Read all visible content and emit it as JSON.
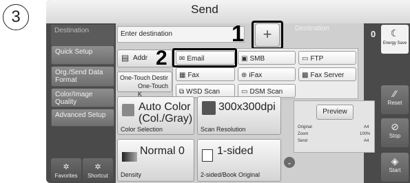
{
  "step_number": "3",
  "header": {
    "title": "Send"
  },
  "nav": {
    "destination": "Destination",
    "quick_setup": "Quick Setup",
    "org_send": "Org./Send Data Format",
    "color_image": "Color/Image Quality",
    "advanced": "Advanced Setup",
    "favorites": "Favorites",
    "shortcut": "Shortcut"
  },
  "main": {
    "dest_placeholder": "Enter destination",
    "plus_label": "+",
    "address_book": "Addr",
    "one_touch_line1": "One-Touch Destir",
    "one_touch_line2": "One-Touch K"
  },
  "menu": {
    "email": "Email",
    "smb": "SMB",
    "ftp": "FTP",
    "fax": "Fax",
    "ifax": "iFax",
    "fax_server": "Fax Server",
    "wsd_scan": "WSD Scan",
    "dsm_scan": "DSM Scan"
  },
  "callouts": {
    "one": "1",
    "two": "2"
  },
  "tiles": {
    "color_value": "Auto Color (Col./Gray)",
    "color_label": "Color Selection",
    "res_value": "300x300dpi",
    "res_label": "Scan Resolution",
    "density_value": "Normal 0",
    "density_label": "Density",
    "sided_value": "1-sided",
    "sided_label": "2-sided/Book Original"
  },
  "preview": {
    "dest_label": "Destination",
    "dest_count": "0",
    "button": "Preview",
    "original_label": "Original",
    "original_value": "A4",
    "zoom_label": "Zoom",
    "zoom_value": "100%",
    "send_label": "Send",
    "send_value": "A4"
  },
  "rail": {
    "energy": "Energy Save",
    "reset": "Reset",
    "stop": "Stop",
    "start": "Start"
  }
}
